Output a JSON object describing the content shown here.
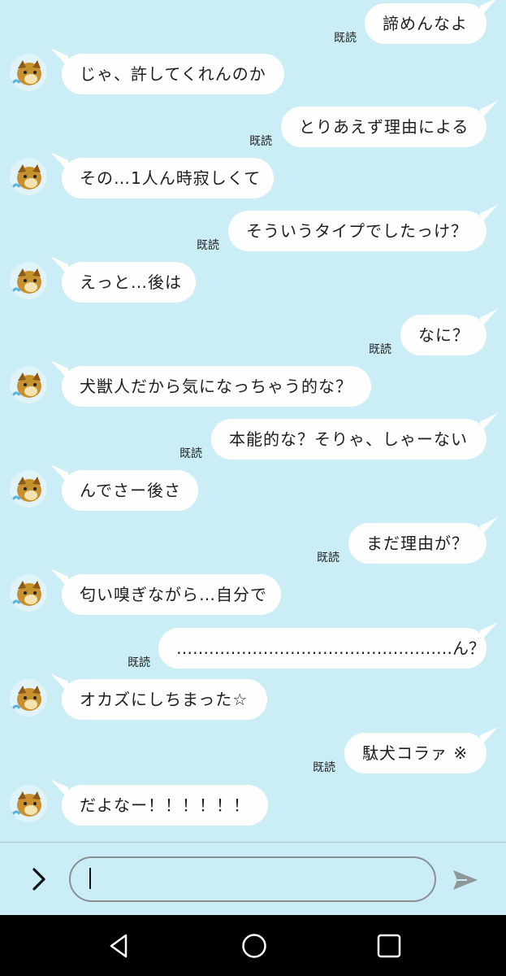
{
  "read_label": "既読",
  "messages": [
    {
      "side": "right",
      "text": "諦めんなよ"
    },
    {
      "side": "left",
      "text": "じゃ、許してくれんのか"
    },
    {
      "side": "right",
      "text": "とりあえず理由による"
    },
    {
      "side": "left",
      "text": "その…1人ん時寂しくて"
    },
    {
      "side": "right",
      "text": "そういうタイプでしたっけ？"
    },
    {
      "side": "left",
      "text": "えっと…後は"
    },
    {
      "side": "right",
      "text": "なに？"
    },
    {
      "side": "left",
      "text": "犬獣人だから気になっちゃう的な？"
    },
    {
      "side": "right",
      "text": "本能的な？そりゃ、しゃーない"
    },
    {
      "side": "left",
      "text": "んでさー後さ"
    },
    {
      "side": "right",
      "text": "まだ理由が？"
    },
    {
      "side": "left",
      "text": "匂い嗅ぎながら…自分で"
    },
    {
      "side": "right",
      "text": "……………………………………………ん？"
    },
    {
      "side": "left",
      "text": "オカズにしちまった☆"
    },
    {
      "side": "right",
      "text": "駄犬コラァ ※"
    },
    {
      "side": "left",
      "text": "だよなー！！！！！！"
    }
  ],
  "input": {
    "value": ""
  },
  "icons": {
    "expand": "chevron-right-icon",
    "send": "send-icon",
    "back": "nav-back-icon",
    "home": "nav-home-icon",
    "recent": "nav-recent-icon"
  },
  "colors": {
    "background": "#cbeef6",
    "bubble": "#fefefe",
    "navbar": "#000000"
  }
}
